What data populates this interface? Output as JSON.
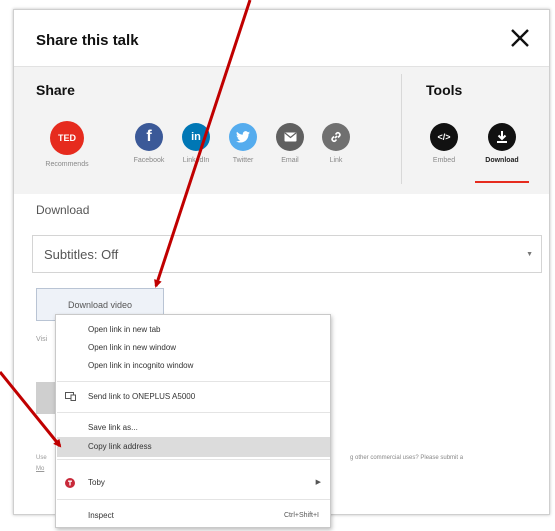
{
  "dialog": {
    "title": "Share this talk",
    "close_icon": "close-icon",
    "share_section_label": "Share",
    "tools_section_label": "Tools"
  },
  "share_buttons": [
    {
      "label": "Recommends",
      "icon": "ted-logo-icon",
      "icon_text": "TED",
      "color": "#e62b1e"
    },
    {
      "label": "Facebook",
      "icon": "facebook-icon",
      "icon_text": "f",
      "color": "#3b5998"
    },
    {
      "label": "LinkedIn",
      "icon": "linkedin-icon",
      "icon_text": "in",
      "color": "#0077b5"
    },
    {
      "label": "Twitter",
      "icon": "twitter-icon",
      "color": "#55acee"
    },
    {
      "label": "Email",
      "icon": "email-icon",
      "color": "#606060"
    },
    {
      "label": "Link",
      "icon": "link-icon",
      "color": "#707070"
    }
  ],
  "tool_buttons": [
    {
      "label": "Embed",
      "icon": "embed-icon",
      "icon_text": "</>",
      "color": "#111111"
    },
    {
      "label": "Download",
      "icon": "download-icon",
      "color": "#111111",
      "active": true
    }
  ],
  "download": {
    "heading": "Download",
    "subtitles_value": "Subtitles: Off",
    "button_label": "Download video",
    "via_text": "Visi",
    "footer_text": "Use",
    "footer_link": "Mo",
    "footer_right": "g other commercial uses? Please submit a"
  },
  "context_menu": {
    "items": [
      {
        "label": "Open link in new tab"
      },
      {
        "label": "Open link in new window"
      },
      {
        "label": "Open link in incognito window"
      },
      {
        "label": "Send link to ONEPLUS A5000",
        "icon": "device-icon"
      },
      {
        "label": "Save link as..."
      },
      {
        "label": "Copy link address",
        "highlighted": true
      },
      {
        "label": "Toby",
        "icon": "toby-icon",
        "has_submenu": true
      },
      {
        "label": "Inspect",
        "shortcut": "Ctrl+Shift+I"
      }
    ]
  },
  "annotation": {
    "arrow_color": "#c00000"
  }
}
